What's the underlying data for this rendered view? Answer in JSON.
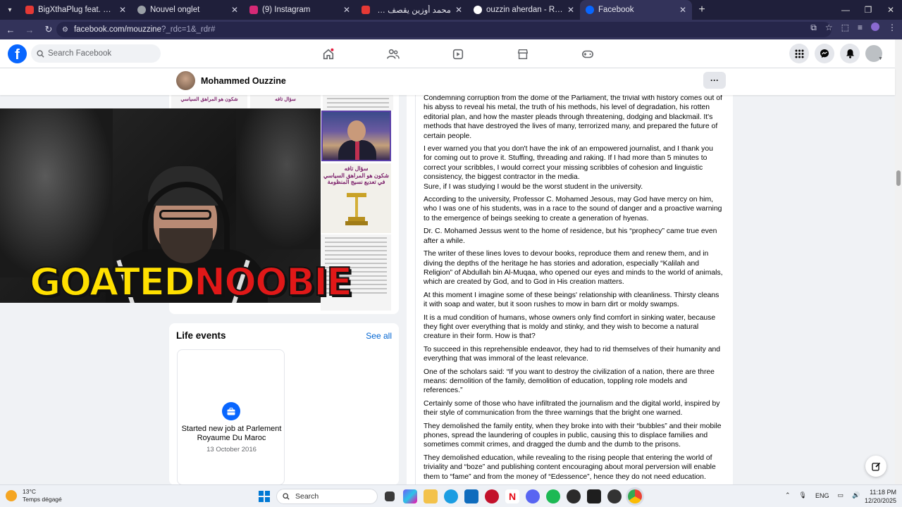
{
  "browser": {
    "tabs": [
      {
        "label": "BigXthaPlug feat. Offset - Climb",
        "favicon_color": "#e53935"
      },
      {
        "label": "Nouvel onglet",
        "favicon_color": "#9aa0a6"
      },
      {
        "label": "(9) Instagram",
        "favicon_color": "#d62976"
      },
      {
        "label": "محمد أوزين يقصف شوف تيفي",
        "favicon_color": "#e53935"
      },
      {
        "label": "ouzzin aherdan - Recherche Goo",
        "favicon_color": "#ffffff"
      },
      {
        "label": "Facebook",
        "favicon_color": "#0866ff"
      }
    ],
    "active_tab_index": 5,
    "url_main": "facebook.com/mouzzine",
    "url_rest": "?_rdc=1&_rdr#"
  },
  "facebook": {
    "search_placeholder": "Search Facebook"
  },
  "profile": {
    "name": "Mohammed Ouzzine",
    "more_label": "···"
  },
  "overlay": {
    "part1": "GOATED",
    "part2": "NOOBIE"
  },
  "photos": {
    "headline_1": "شكون هو المراهق السياسي",
    "headline_2": "في تعديع نسيج المنظومة",
    "headline_3": "سؤال تافه"
  },
  "life_events": {
    "title": "Life events",
    "see_all": "See all",
    "event_title": "Started new job at Parlement Royaume Du Maroc",
    "event_date": "13 October 2016"
  },
  "post": {
    "paragraphs": [
      "Condemning corruption from the dome of the Parliament, the trivial with history comes out of his abyss to reveal his metal, the truth of his methods, his level of degradation, his rotten editorial plan, and how the master pleads through threatening, dodging and blackmail. It's methods that have destroyed the lives of many, terrorized many, and prepared the future of certain people.",
      "I ever warned you that you don't have the ink of an empowered journalist, and I thank you for coming out to prove it. Stuffing, threading and raking. If I had more than 5 minutes to correct your scribbles, I would correct your missing scribbles of cohesion and linguistic consistency, the biggest contractor in the media.\nSure, if I was studying I would be the worst student in the university.",
      "According to the university, Professor C. Mohamed Jesous, may God have mercy on him, who I was one of his students, was in a race to the sound of danger and a proactive warning to the emergence of beings seeking to create a generation of hyenas.",
      "Dr. C. Mohamed Jessus went to the home of residence, but his “prophecy” came true even after a while.",
      "The writer of these lines loves to devour books, reproduce them and renew them, and in diving the depths of the heritage he has stories and adoration, especially “Kalilah and Religion” of Abdullah bin Al-Muqaa, who opened our eyes and minds to the world of animals, which are created by God, and to God in His creation matters.",
      "At this moment I imagine some of these beings' relationship with cleanliness. Thirsty cleans it with soap and water, but it soon rushes to mow in barn dirt or moldy swamps.",
      "It is a mud condition of humans, whose owners only find comfort in sinking water, because they fight over everything that is moldy and stinky, and they wish to become a natural creature in their form. How is that?",
      "To succeed in this reprehensible endeavor, they had to rid themselves of their humanity and everything that was immoral of the least relevance.",
      "One of the scholars said: “If you want to destroy the civilization of a nation, there are three means: demolition of the family, demolition of education, toppling role models and references.”",
      "Certainly some of those who have infiltrated the journalism and the digital world, inspired by their style of communication from the three warnings that the bright one warned.",
      "They demolished the family entity, when they broke into with their “bubbles” and their mobile phones, spread the laundering of couples in public, causing this to displace families and sometimes commit crimes, and dragged the dumb and the dumb to the prisons.",
      "They demolished education, while revealing to the rising people that entering the world of triviality and “boze” and publishing content encouraging about moral perversion will enable them to “fame” and from the money of “Edessence”, hence they do not need education."
    ]
  },
  "taskbar": {
    "temperature": "13°C",
    "weather": "Temps dégagé",
    "search_label": "Search",
    "language": "ENG",
    "time": "11:18 PM",
    "date": "12/20/2025"
  },
  "colors": {
    "fb_blue": "#0866ff",
    "link_blue": "#0064d1",
    "browser_dark": "#1f1f3a",
    "overlay_yellow": "#ffe000",
    "overlay_red": "#e01818"
  }
}
